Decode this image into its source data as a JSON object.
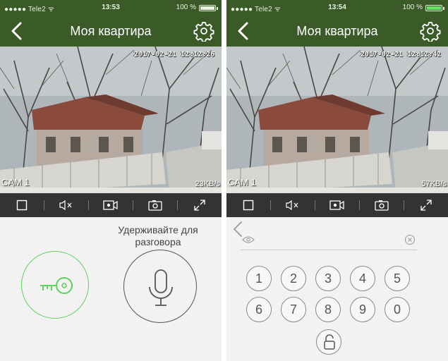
{
  "left": {
    "status": {
      "carrier": "●●●●● Tele2 ᯤ",
      "time": "13:53",
      "battery": "100 %"
    },
    "nav": {
      "title": "Моя квартира"
    },
    "video": {
      "timestamp": "2017-02-21 12:12:26",
      "camera": "CAM 1",
      "rate": "23KB/s"
    },
    "hold_text": "Удерживайте для разговора"
  },
  "right": {
    "status": {
      "carrier": "●●●●● Tele2 ᯤ",
      "time": "13:54",
      "battery": "100 %"
    },
    "nav": {
      "title": "Моя квартира"
    },
    "video": {
      "timestamp": "2017-02-21 12:12:42",
      "camera": "CAM 1",
      "rate": "57KB/s"
    },
    "pin": {
      "value": ""
    },
    "keypad": [
      "1",
      "2",
      "3",
      "4",
      "5",
      "6",
      "7",
      "8",
      "9",
      "0"
    ]
  },
  "icons": {
    "back": "chevron-left-icon",
    "settings": "gear-icon",
    "toolbar": [
      "fullscreen-square-icon",
      "mute-icon",
      "record-icon",
      "snapshot-icon",
      "expand-icon"
    ],
    "key": "key-icon",
    "mic": "microphone-icon",
    "eye": "eye-icon",
    "clear": "clear-icon",
    "unlock": "unlock-icon"
  },
  "colors": {
    "header": "#3a5b28",
    "toolbar": "#333333",
    "accent": "#5fd15f",
    "background": "#f2f2f2"
  }
}
